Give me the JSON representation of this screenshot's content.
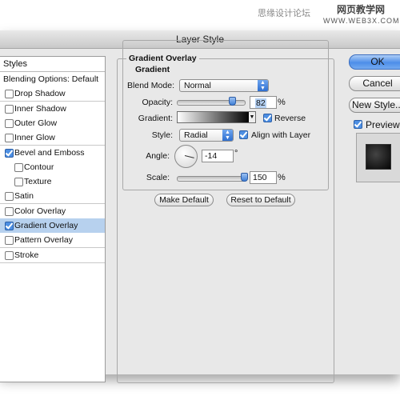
{
  "watermark": {
    "left_text": "思缘设计论坛",
    "title": "网页教学网",
    "url": "WWW.WEB3X.COM"
  },
  "window": {
    "title": "Layer Style"
  },
  "styles_list": {
    "header": "Styles",
    "items": [
      {
        "label": "Blending Options: Default",
        "has_checkbox": false,
        "checked": false,
        "selected": false,
        "indent": false
      },
      {
        "label": "Drop Shadow",
        "has_checkbox": true,
        "checked": false,
        "selected": false,
        "indent": false
      },
      {
        "label": "Inner Shadow",
        "has_checkbox": true,
        "checked": false,
        "selected": false,
        "indent": false
      },
      {
        "label": "Outer Glow",
        "has_checkbox": true,
        "checked": false,
        "selected": false,
        "indent": false
      },
      {
        "label": "Inner Glow",
        "has_checkbox": true,
        "checked": false,
        "selected": false,
        "indent": false
      },
      {
        "label": "Bevel and Emboss",
        "has_checkbox": true,
        "checked": true,
        "selected": false,
        "indent": false
      },
      {
        "label": "Contour",
        "has_checkbox": true,
        "checked": false,
        "selected": false,
        "indent": true
      },
      {
        "label": "Texture",
        "has_checkbox": true,
        "checked": false,
        "selected": false,
        "indent": true
      },
      {
        "label": "Satin",
        "has_checkbox": true,
        "checked": false,
        "selected": false,
        "indent": false
      },
      {
        "label": "Color Overlay",
        "has_checkbox": true,
        "checked": false,
        "selected": false,
        "indent": false
      },
      {
        "label": "Gradient Overlay",
        "has_checkbox": true,
        "checked": true,
        "selected": true,
        "indent": false
      },
      {
        "label": "Pattern Overlay",
        "has_checkbox": true,
        "checked": false,
        "selected": false,
        "indent": false
      },
      {
        "label": "Stroke",
        "has_checkbox": true,
        "checked": false,
        "selected": false,
        "indent": false
      }
    ]
  },
  "gradient_overlay": {
    "group_title": "Gradient Overlay",
    "sub_title": "Gradient",
    "blend_mode_label": "Blend Mode:",
    "blend_mode_value": "Normal",
    "opacity_label": "Opacity:",
    "opacity_value": "82",
    "opacity_percent": 82,
    "percent_sign": "%",
    "gradient_label": "Gradient:",
    "reverse_label": "Reverse",
    "reverse_checked": true,
    "style_label": "Style:",
    "style_value": "Radial",
    "align_label": "Align with Layer",
    "align_checked": true,
    "angle_label": "Angle:",
    "angle_value": "-14",
    "degree_sign": "°",
    "scale_label": "Scale:",
    "scale_value": "150",
    "scale_percent": 150,
    "make_default": "Make Default",
    "reset_default": "Reset to Default"
  },
  "buttons": {
    "ok": "OK",
    "cancel": "Cancel",
    "new_style": "New Style...",
    "preview_label": "Preview",
    "preview_checked": true
  },
  "colors": {
    "accent": "#4d8ee9",
    "selection": "#b7d1ee"
  }
}
